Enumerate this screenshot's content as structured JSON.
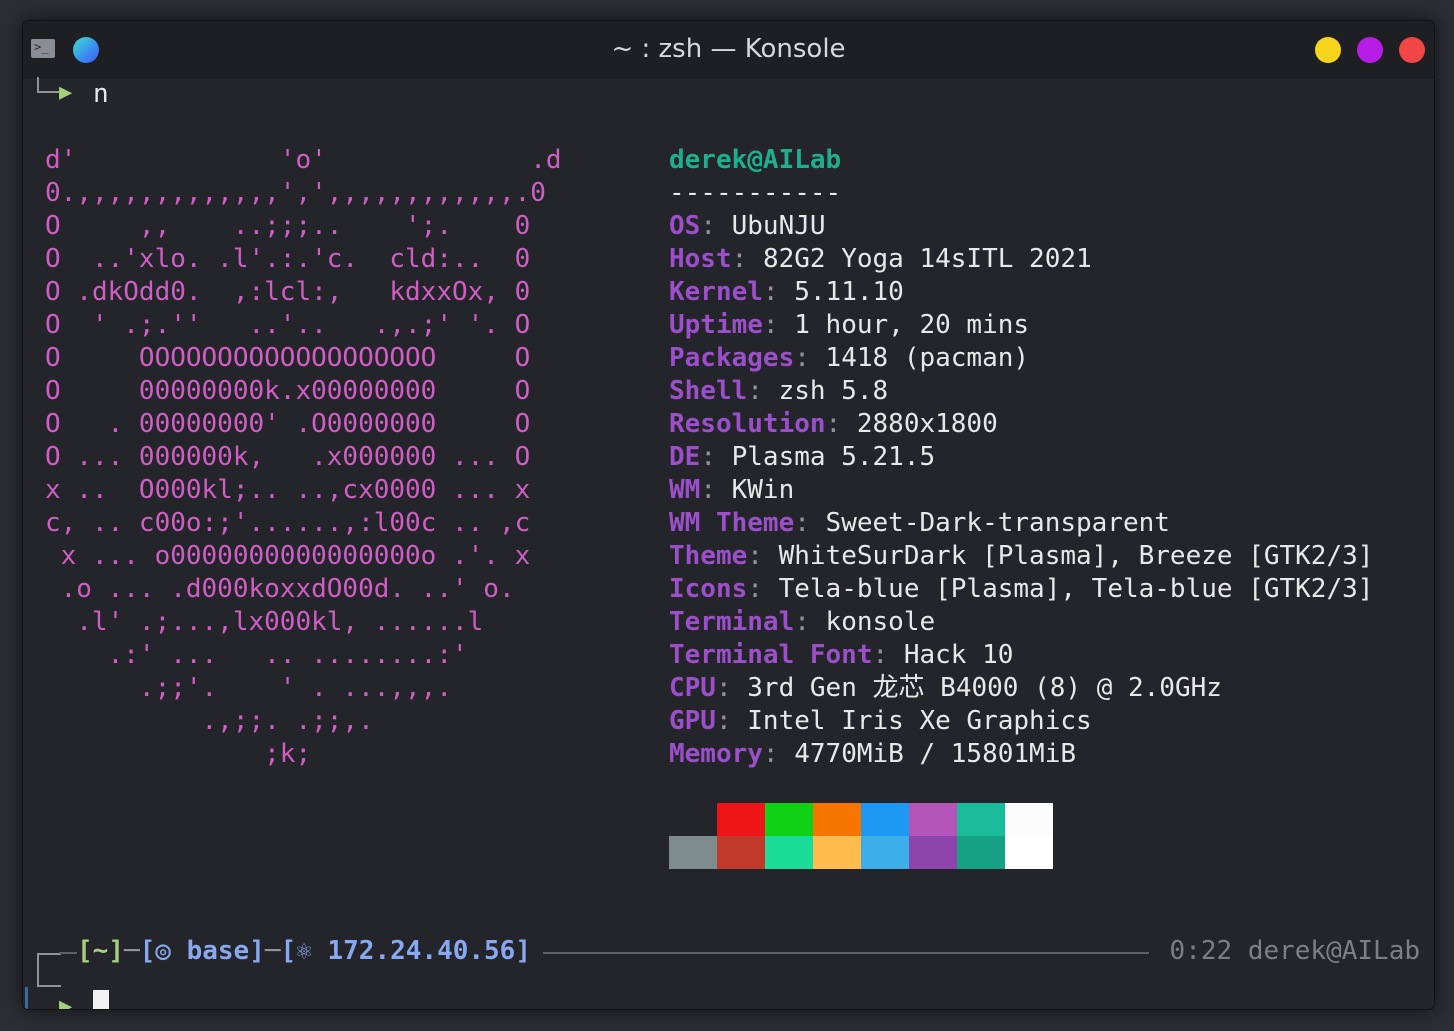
{
  "window": {
    "title": "~ : zsh — Konsole"
  },
  "previous_command": "n",
  "art_lines": [
    "d'             'o'             .d",
    "0.,,,,,,,,,,,,,',',,,,,,,,,,,,.0",
    "O     ,,    ..;;;..    ';.    0",
    "O  ..'xlo. .l'.:.'c.  cld:..  0",
    "O .dkOdd0.  ,:lcl:,   kdxxOx, 0",
    "O  ' .;.''   ..'..   .,.;' '. O",
    "O     OOOOOOOOOOOOOOOOOOO     O",
    "O     00000000k.x00000000     O",
    "O   . 00000000' .O0000000     O",
    "O ... 000000k,   .x000000 ... O",
    "x ..  O000kl;.. ..,cx0000 ... x",
    "c, .. c00o:;'......,:l00c .. ,c",
    " x ... o0000000000000000o .'. x",
    " .o ... .d000koxxdO00d. ..' o.",
    "  .l' .;...,lx000kl, ......l",
    "    .:' ...   .. ........:'",
    "      .;;'.    ' . ...,,,.",
    "          .,;;. .;;,.",
    "              ;k;"
  ],
  "info": {
    "header": "derek@AILab",
    "separator": "-----------",
    "rows": [
      {
        "key": "OS",
        "value": "UbuNJU"
      },
      {
        "key": "Host",
        "value": "82G2 Yoga 14sITL 2021"
      },
      {
        "key": "Kernel",
        "value": "5.11.10"
      },
      {
        "key": "Uptime",
        "value": "1 hour, 20 mins"
      },
      {
        "key": "Packages",
        "value": "1418 (pacman)"
      },
      {
        "key": "Shell",
        "value": "zsh 5.8"
      },
      {
        "key": "Resolution",
        "value": "2880x1800"
      },
      {
        "key": "DE",
        "value": "Plasma 5.21.5"
      },
      {
        "key": "WM",
        "value": "KWin"
      },
      {
        "key": "WM Theme",
        "value": "Sweet-Dark-transparent"
      },
      {
        "key": "Theme",
        "value": "WhiteSurDark [Plasma], Breeze [GTK2/3]"
      },
      {
        "key": "Icons",
        "value": "Tela-blue [Plasma], Tela-blue [GTK2/3]"
      },
      {
        "key": "Terminal",
        "value": "konsole"
      },
      {
        "key": "Terminal Font",
        "value": "Hack 10"
      },
      {
        "key": "CPU",
        "value": "3rd Gen 龙芯 B4000 (8) @ 2.0GHz"
      },
      {
        "key": "GPU",
        "value": "Intel Iris Xe Graphics"
      },
      {
        "key": "Memory",
        "value": "4770MiB / 15801MiB"
      }
    ]
  },
  "palette": {
    "top": [
      "#23252a",
      "#ed1515",
      "#11d116",
      "#f67400",
      "#1d99f3",
      "#b454b8",
      "#1abc9c",
      "#fcfcfc"
    ],
    "bottom": [
      "#7f8c8d",
      "#c0392b",
      "#1cdc9a",
      "#fdbc4b",
      "#3daee9",
      "#8e44ad",
      "#16a085",
      "#ffffff"
    ]
  },
  "prompt": {
    "dir": "~",
    "env_icon": "◎",
    "env": "base",
    "ip_icon": "⚛",
    "ip": "172.24.40.56",
    "status": "0:22 derek@AILab"
  }
}
